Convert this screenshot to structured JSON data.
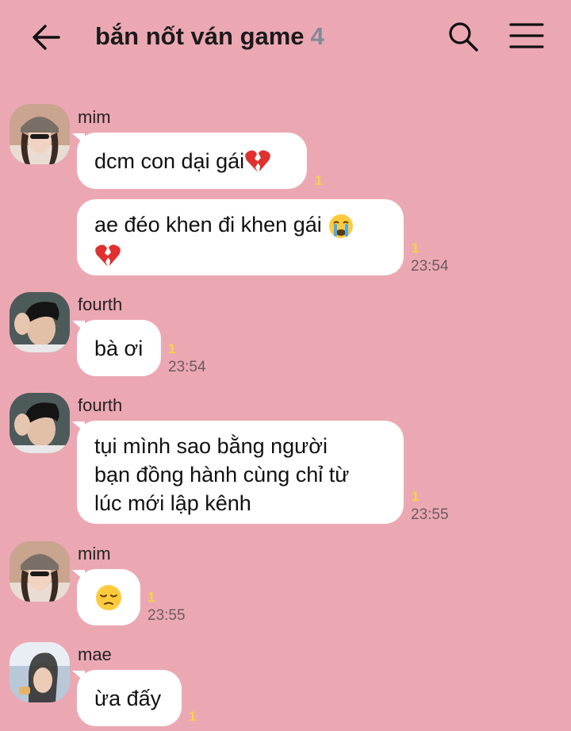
{
  "header": {
    "title": "bắn nốt ván game",
    "member_count": "4",
    "icons": [
      "back-arrow-icon",
      "search-icon",
      "menu-icon"
    ]
  },
  "messages": [
    {
      "sender": "mim",
      "avatar": "avatar-mim",
      "text": "dcm con dại gái",
      "emoji": "broken-heart",
      "unread": "1",
      "time": ""
    },
    {
      "sender": "mim",
      "text": "ae đéo khen đi khen gái",
      "emoji": "crying-face + broken-heart",
      "unread": "1",
      "time": "23:54"
    },
    {
      "sender": "fourth",
      "avatar": "avatar-fourth",
      "text": "bà ơi",
      "unread": "1",
      "time": "23:54"
    },
    {
      "sender": "fourth",
      "avatar": "avatar-fourth",
      "lines": [
        "tụi mình sao bằng người",
        "bạn đồng hành cùng chỉ từ",
        "lúc mới lập kênh"
      ],
      "unread": "1",
      "time": "23:55"
    },
    {
      "sender": "mim",
      "avatar": "avatar-mim",
      "text": "",
      "emoji": "pensive-face",
      "unread": "1",
      "time": "23:55"
    },
    {
      "sender": "mae",
      "avatar": "avatar-mae",
      "text": "ừa đấy",
      "unread": "1",
      "time": ""
    }
  ],
  "colors": {
    "background": "#eba8b3",
    "bubble": "#ffffff",
    "unread": "#f7d63b"
  }
}
